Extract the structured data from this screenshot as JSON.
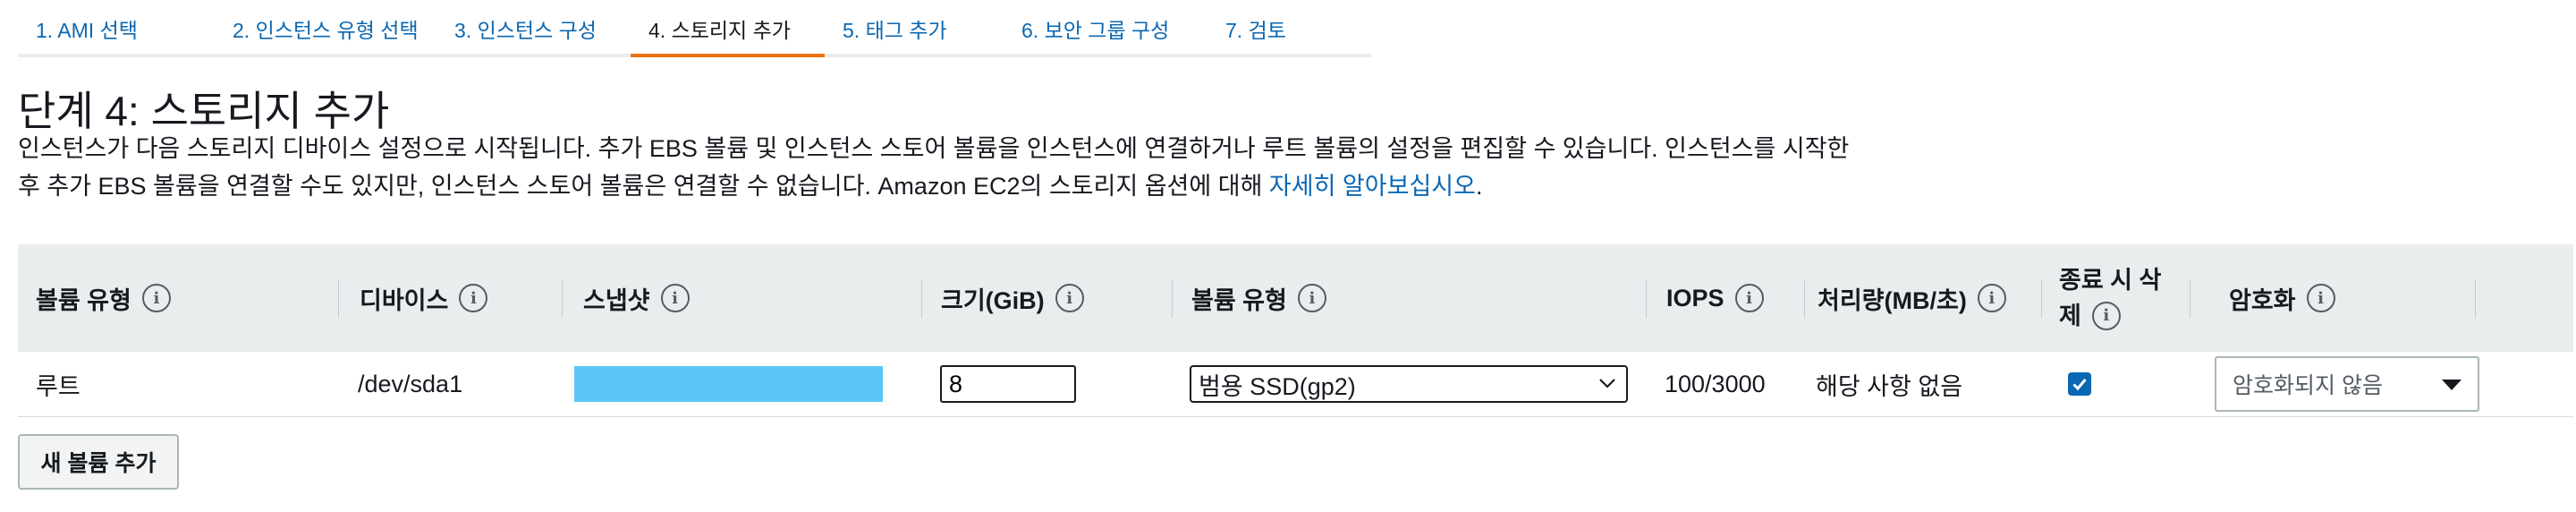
{
  "tabs": [
    {
      "label": "1. AMI 선택"
    },
    {
      "label": "2. 인스턴스 유형 선택"
    },
    {
      "label": "3. 인스턴스 구성"
    },
    {
      "label": "4. 스토리지 추가"
    },
    {
      "label": "5. 태그 추가"
    },
    {
      "label": "6. 보안 그룹 구성"
    },
    {
      "label": "7. 검토"
    }
  ],
  "active_tab": "4. 스토리지 추가",
  "page": {
    "title": "단계 4: 스토리지 추가",
    "description_line1": "인스턴스가 다음 스토리지 디바이스 설정으로 시작됩니다. 추가 EBS 볼륨 및 인스턴스 스토어 볼륨을 인스턴스에 연결하거나 루트 볼륨의 설정을 편집할 수 있습니다. 인스턴스를 시작한",
    "description_line2": "후 추가 EBS 볼륨을 연결할 수도 있지만, 인스턴스 스토어 볼륨은 연결할 수 없습니다. Amazon EC2의 스토리지 옵션에 대해 ",
    "learn_more_link": "자세히 알아보십시오",
    "description_end": "."
  },
  "table": {
    "headers": {
      "volume_type": "볼륨 유형",
      "device": "디바이스",
      "snapshot": "스냅샷",
      "size": "크기(GiB)",
      "volume_kind": "볼륨 유형",
      "iops": "IOPS",
      "throughput": "처리량(MB/초)",
      "delete_on_termination_line1": "종료 시 삭",
      "delete_on_termination_line2": "제",
      "encryption": "암호화"
    },
    "row": {
      "volume_type": "루트",
      "device": "/dev/sda1",
      "snapshot": "",
      "size": "8",
      "volume_kind": "범용 SSD(gp2)",
      "iops": "100/3000",
      "throughput": "해당 사항 없음",
      "delete_on_termination": true,
      "encryption": "암호화되지 않음"
    }
  },
  "buttons": {
    "add_volume": "새 볼륨 추가"
  },
  "colors": {
    "link": "#0b67b2",
    "active_tab_underline": "#ec7211",
    "snapshot_highlight": "#5bc6f6",
    "header_bg": "#eaeded"
  }
}
